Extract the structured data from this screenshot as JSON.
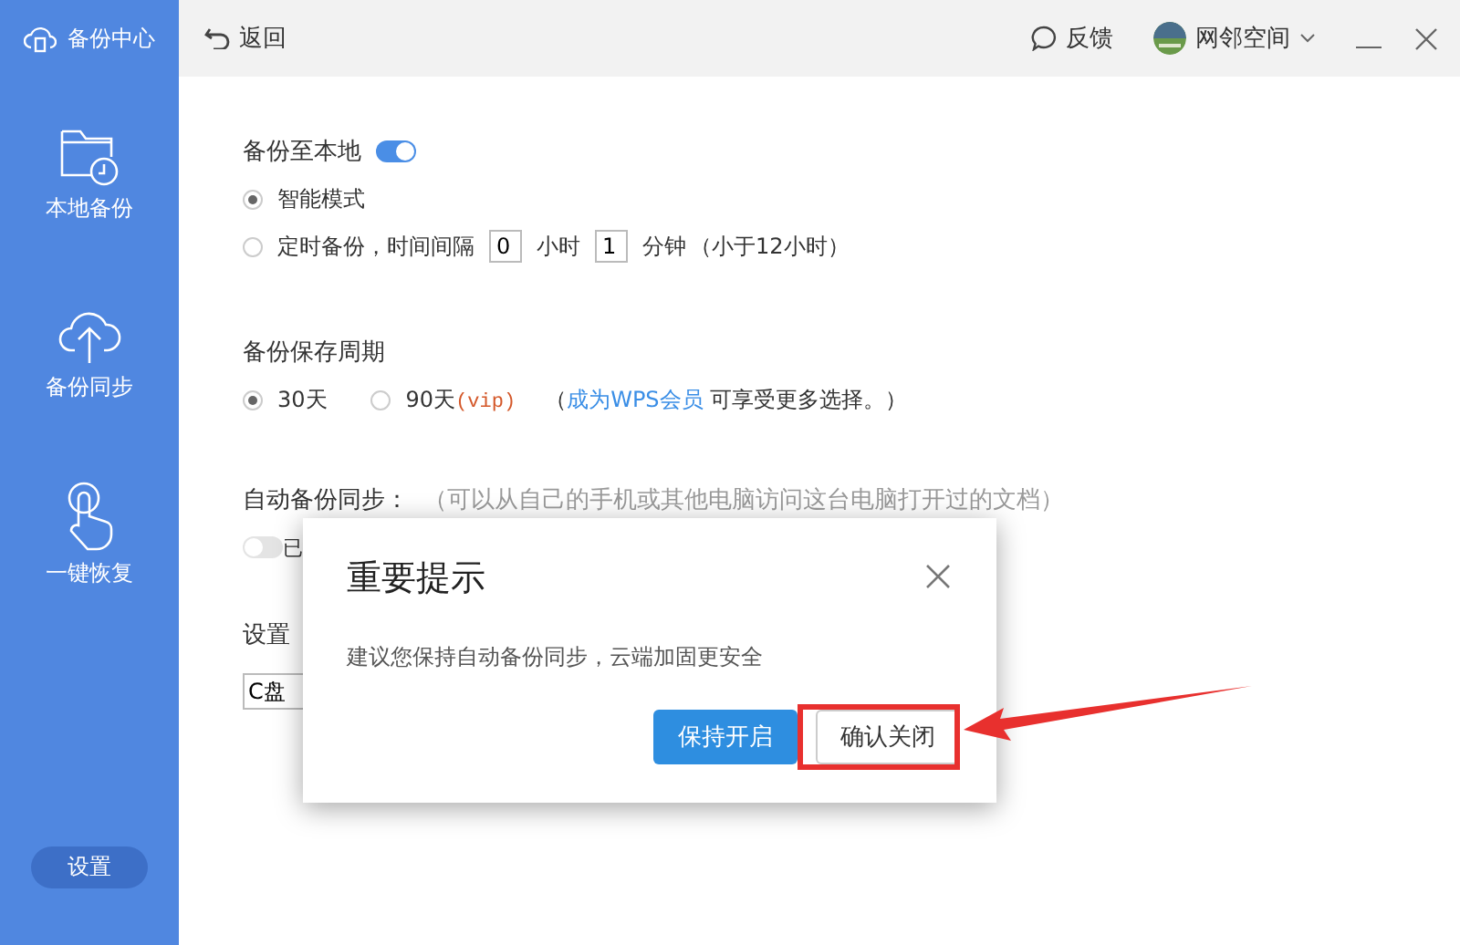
{
  "sidebar": {
    "title": "备份中心",
    "items": [
      {
        "label": "本地备份",
        "kind": "folder"
      },
      {
        "label": "备份同步",
        "kind": "cloud"
      },
      {
        "label": "一键恢复",
        "kind": "hand"
      }
    ],
    "settings_button": "设置"
  },
  "topbar": {
    "back": "返回",
    "feedback": "反馈",
    "user": "网邻空间"
  },
  "local_backup": {
    "title": "备份至本地",
    "on": true,
    "modes": [
      {
        "label": "智能模式",
        "selected": true,
        "kind": "plain"
      },
      {
        "label": "定时备份，时间间隔",
        "selected": false,
        "kind": "timed",
        "hours": "0",
        "hours_unit": "小时",
        "minutes": "1",
        "minutes_unit": "分钟",
        "note": "（小于12小时）"
      }
    ]
  },
  "retention": {
    "title": "备份保存周期",
    "options": [
      {
        "label": "30天",
        "selected": true
      },
      {
        "label": "90天",
        "tag": "(vip)",
        "selected": false
      }
    ],
    "hint_open": "（",
    "link": "成为WPS会员",
    "hint_rest": "可享受更多选择。）"
  },
  "auto_sync": {
    "title": "自动备份同步：",
    "hint": "（可以从自己的手机或其他电脑访问这台电脑打开过的文档）",
    "on": false,
    "state_label": "已"
  },
  "location": {
    "title": "设置",
    "value": "C盘"
  },
  "dialog": {
    "title": "重要提示",
    "message": "建议您保持自动备份同步，云端加固更安全",
    "primary": "保持开启",
    "secondary": "确认关闭",
    "secondary_highlighted": true
  }
}
